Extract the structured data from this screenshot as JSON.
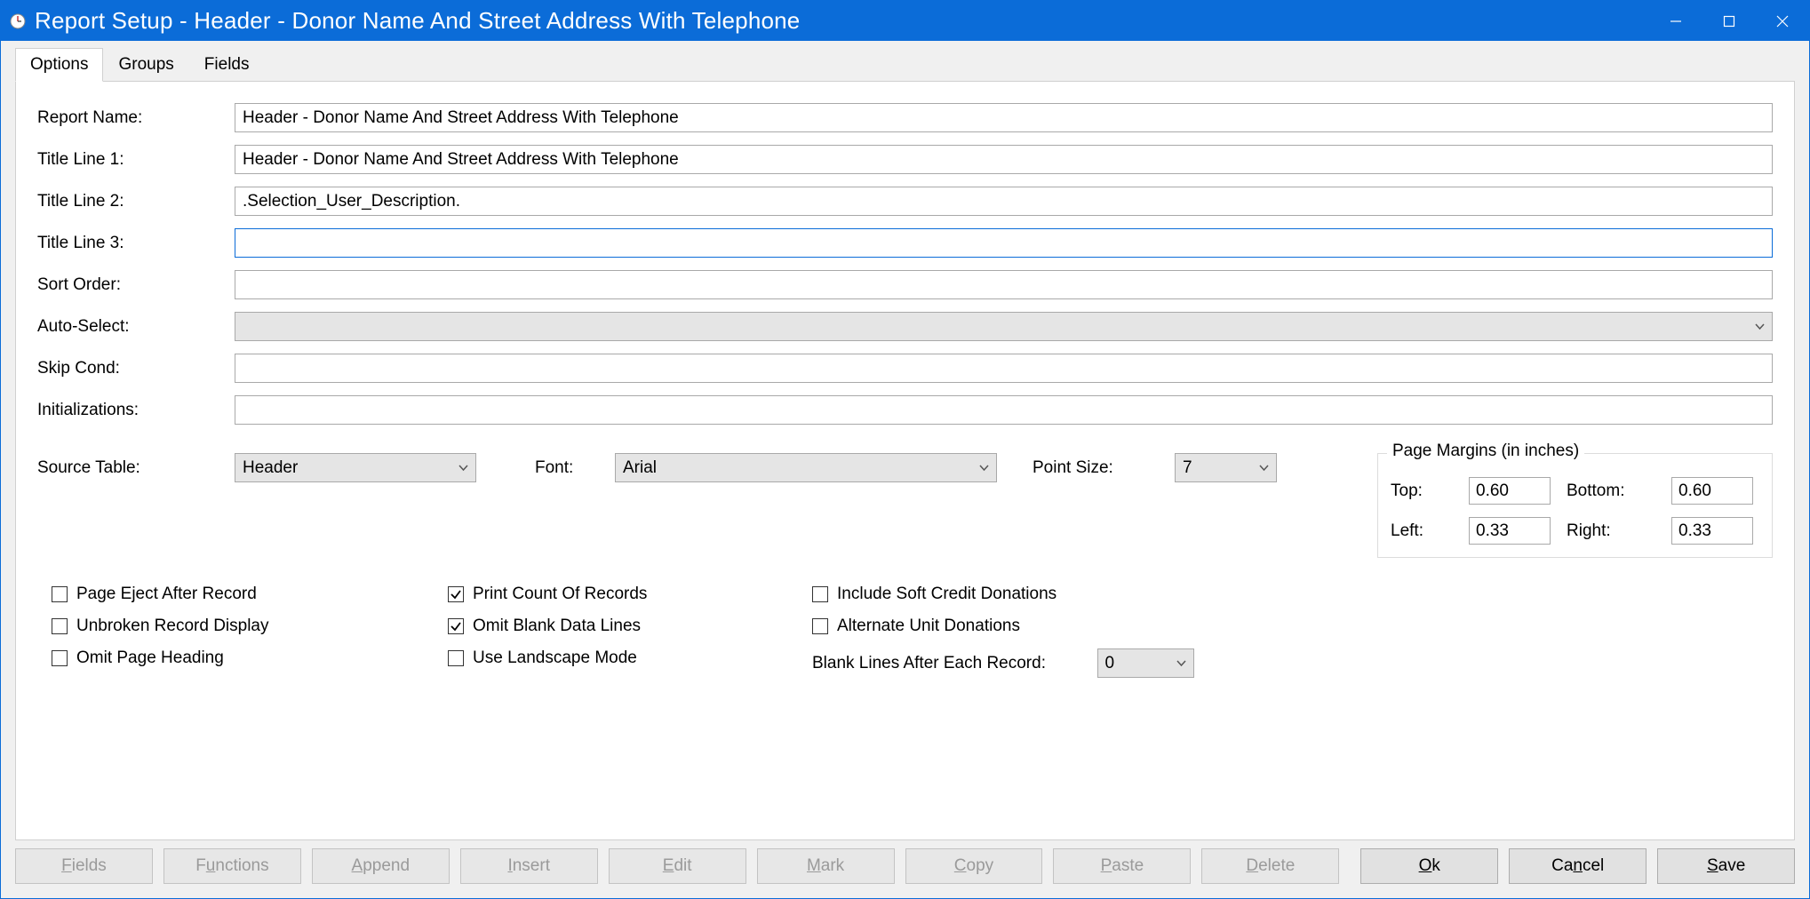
{
  "window_title": "Report Setup - Header - Donor Name And Street Address With Telephone",
  "tabs": {
    "options": "Options",
    "groups": "Groups",
    "fields": "Fields"
  },
  "labels": {
    "report_name": "Report Name:",
    "title_line_1": "Title Line 1:",
    "title_line_2": "Title Line 2:",
    "title_line_3": "Title Line 3:",
    "sort_order": "Sort Order:",
    "auto_select": "Auto-Select:",
    "skip_cond": "Skip Cond:",
    "initializations": "Initializations:",
    "source_table": "Source Table:",
    "font": "Font:",
    "point_size": "Point Size:",
    "page_margins": "Page Margins (in inches)",
    "margin_top": "Top:",
    "margin_bottom": "Bottom:",
    "margin_left": "Left:",
    "margin_right": "Right:",
    "blank_lines": "Blank Lines After Each Record:"
  },
  "values": {
    "report_name": "Header - Donor Name And Street Address With Telephone",
    "title_line_1": "Header - Donor Name And Street Address With Telephone",
    "title_line_2": ".Selection_User_Description.",
    "title_line_3": "",
    "sort_order": "",
    "auto_select": "",
    "skip_cond": "",
    "initializations": "",
    "source_table": "Header",
    "font": "Arial",
    "point_size": "7",
    "margin_top": "0.60",
    "margin_bottom": "0.60",
    "margin_left": "0.33",
    "margin_right": "0.33",
    "blank_lines": "0"
  },
  "checkboxes": {
    "page_eject": {
      "label": "Page Eject After Record",
      "checked": false
    },
    "unbroken": {
      "label": "Unbroken Record Display",
      "checked": false
    },
    "omit_heading": {
      "label": "Omit Page Heading",
      "checked": false
    },
    "print_count": {
      "label": "Print Count Of Records",
      "checked": true
    },
    "omit_blank": {
      "label": "Omit Blank Data Lines",
      "checked": true
    },
    "landscape": {
      "label": "Use Landscape Mode",
      "checked": false
    },
    "soft_credit": {
      "label": "Include Soft Credit Donations",
      "checked": false
    },
    "alternate_unit": {
      "label": "Alternate Unit Donations",
      "checked": false
    }
  },
  "buttons": {
    "fields": "Fields",
    "functions": "Functions",
    "append": "Append",
    "insert": "Insert",
    "edit": "Edit",
    "mark": "Mark",
    "copy": "Copy",
    "paste": "Paste",
    "delete": "Delete",
    "ok": "Ok",
    "cancel": "Cancel",
    "save": "Save"
  }
}
